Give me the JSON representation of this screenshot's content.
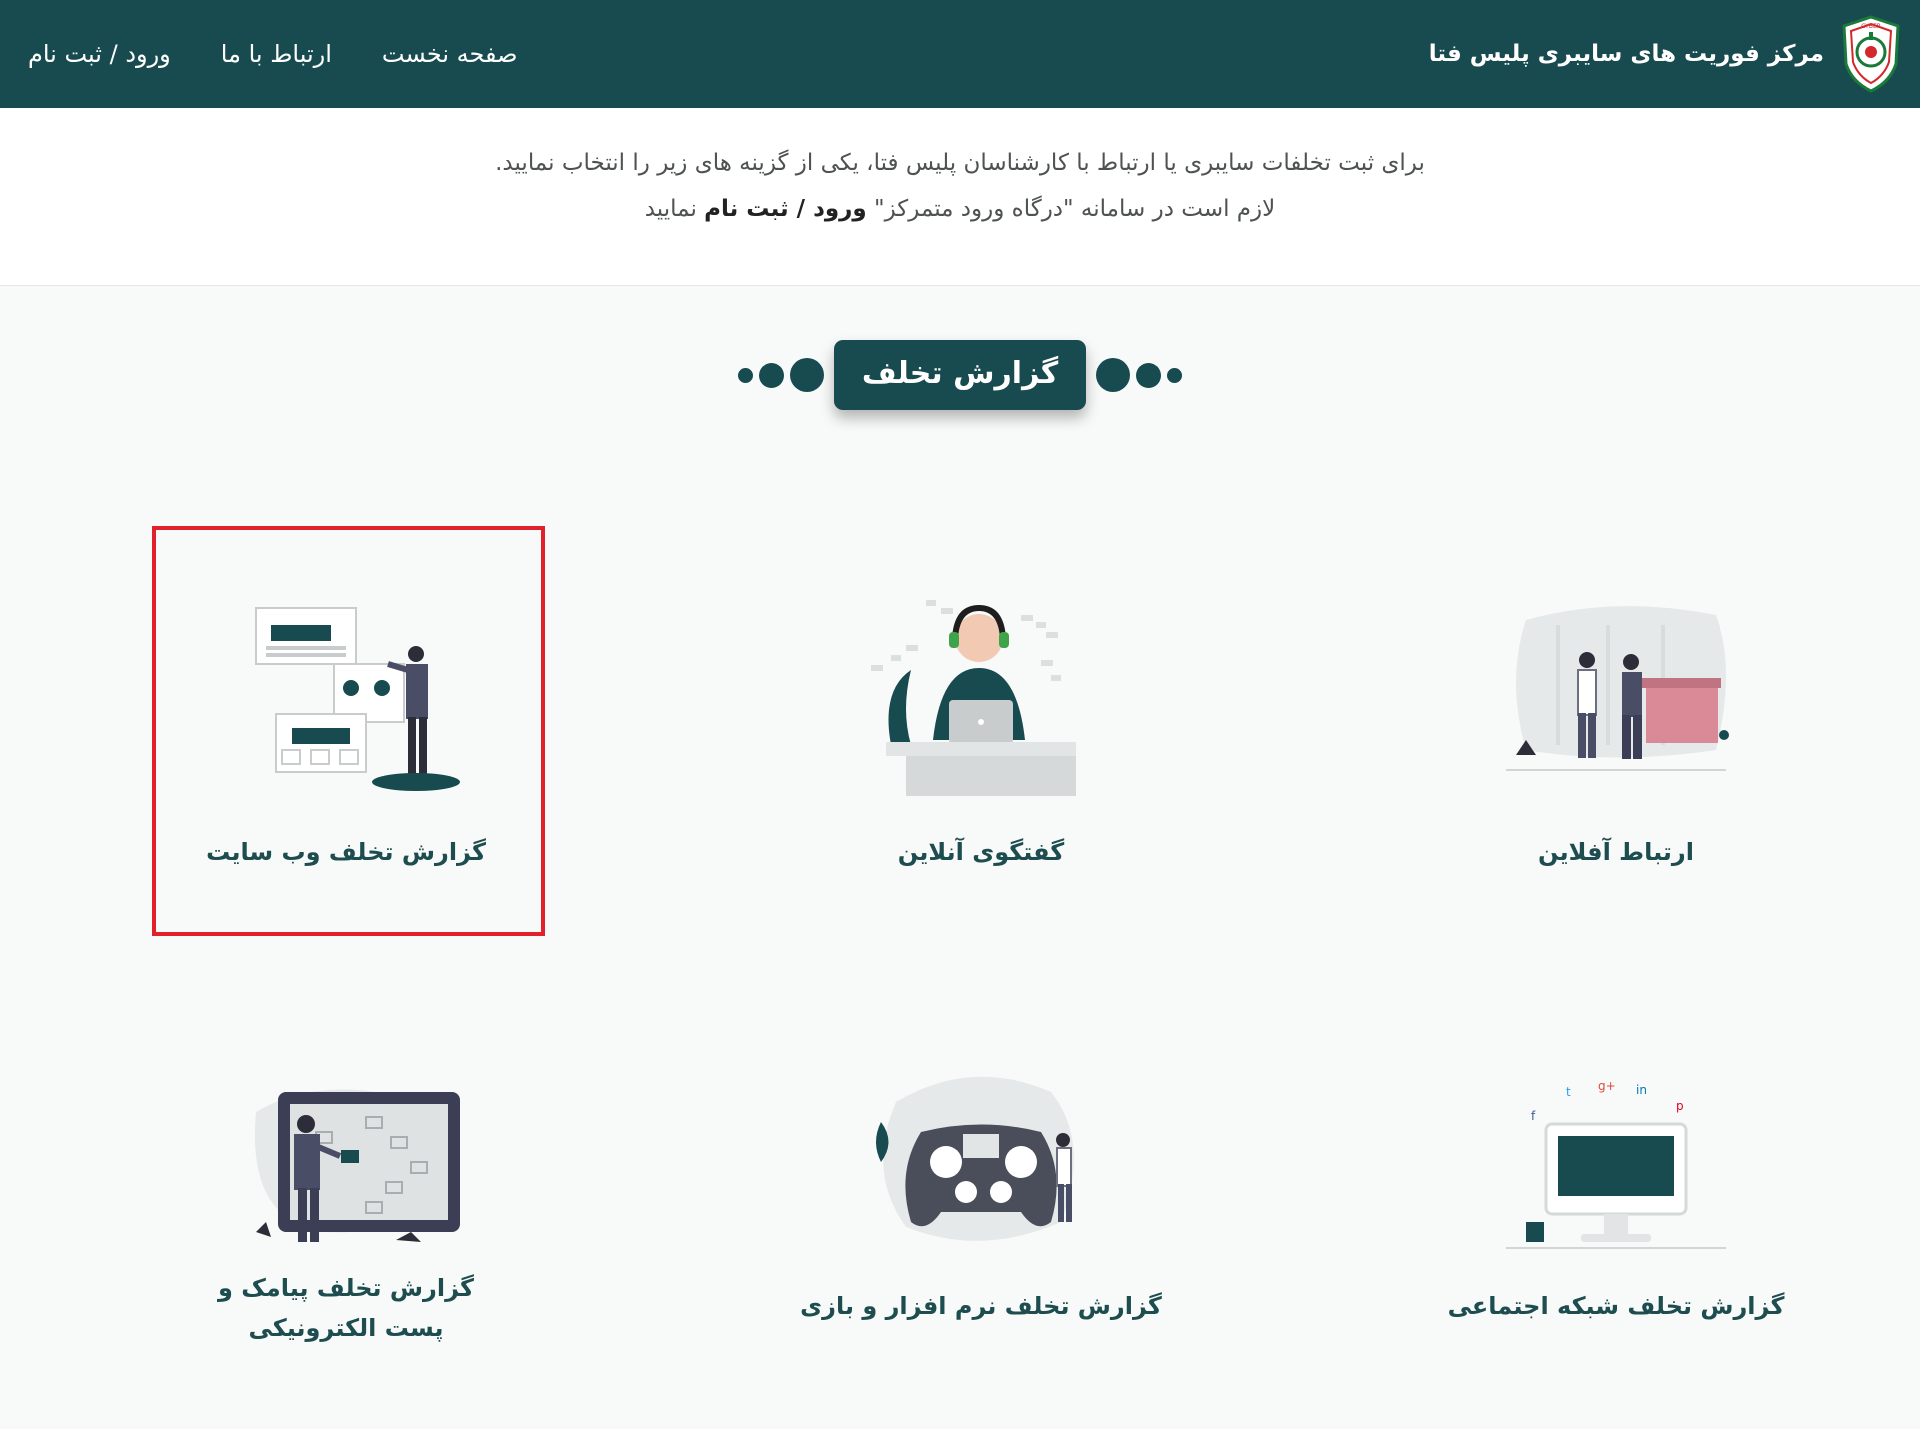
{
  "header": {
    "brand_name": "مرکز فوریت های سایبری پلیس فتا",
    "logo_icon": "police-fata-emblem",
    "nav": {
      "home": "صفحه نخست",
      "contact": "ارتباط با ما",
      "login": "ورود / ثبت نام"
    }
  },
  "intro": {
    "line1": "برای ثبت تخلفات سایبری یا ارتباط با کارشناسان پلیس فتا، یکی از گزینه های زیر را انتخاب نمایید.",
    "line2_prefix": "لازم است در سامانه \"درگاه ورود متمرکز\"",
    "line2_link": "ورود / ثبت نام",
    "line2_suffix": "نمایید"
  },
  "section_title": "گزارش تخلف",
  "cards": [
    {
      "label": "ارتباط آفلاین",
      "icon": "offline-contact-illustration"
    },
    {
      "label": "گفتگوی آنلاین",
      "icon": "online-chat-illustration"
    },
    {
      "label": "گزارش تخلف وب سایت",
      "icon": "website-report-illustration",
      "highlighted": true
    },
    {
      "label": "گزارش تخلف شبکه اجتماعی",
      "icon": "social-network-illustration"
    },
    {
      "label": "گزارش تخلف نرم افزار و بازی",
      "icon": "software-game-illustration"
    },
    {
      "label": "گزارش تخلف پیامک و پست الکترونیکی",
      "icon": "sms-email-illustration"
    }
  ],
  "colors": {
    "primary": "#184b4f",
    "highlight": "#e0202a",
    "background": "#f8f9f9"
  }
}
